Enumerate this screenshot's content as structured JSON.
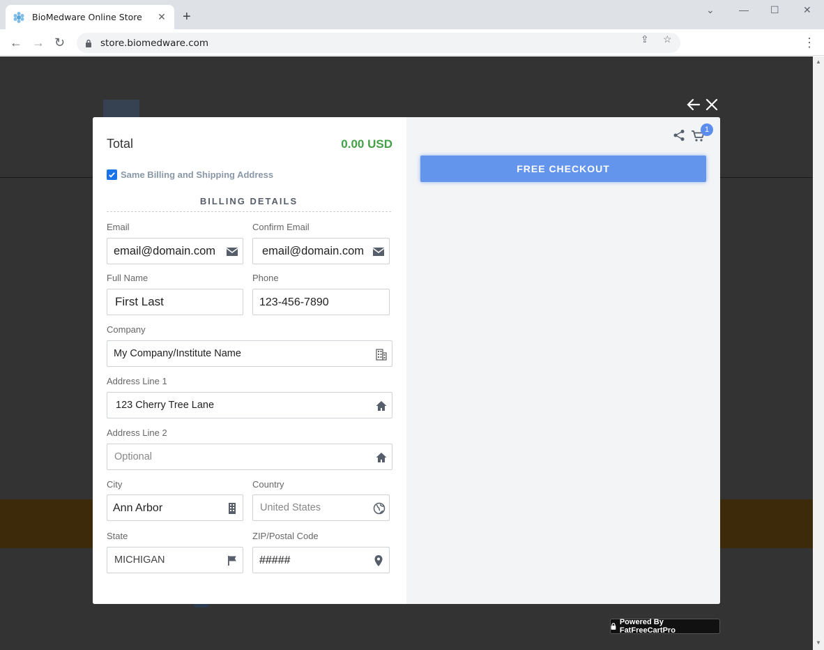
{
  "browser": {
    "tab_title": "BioMedware Online Store",
    "url": "store.biomedware.com"
  },
  "checkout": {
    "total_label": "Total",
    "total_value": "0.00 USD",
    "same_address_label": "Same Billing and Shipping Address",
    "same_address_checked": true,
    "section_title": "BILLING DETAILS",
    "fields": {
      "email": {
        "label": "Email",
        "value": "email@domain.com"
      },
      "confirm_email": {
        "label": "Confirm Email",
        "value": "email@domain.com"
      },
      "full_name": {
        "label": "Full Name",
        "value": "First Last"
      },
      "phone": {
        "label": "Phone",
        "value": "123-456-7890"
      },
      "company": {
        "label": "Company",
        "value": "My Company/Institute Name"
      },
      "address1": {
        "label": "Address Line 1",
        "value": "123 Cherry Tree Lane"
      },
      "address2": {
        "label": "Address Line 2",
        "placeholder": "Optional"
      },
      "city": {
        "label": "City",
        "value": "Ann Arbor"
      },
      "country": {
        "label": "Country",
        "value": "United States"
      },
      "state": {
        "label": "State",
        "value": "MICHIGAN"
      },
      "zip": {
        "label": "ZIP/Postal Code",
        "value": "#####"
      }
    },
    "cart_count": "1",
    "checkout_button": "FREE CHECKOUT",
    "powered_by": "Powered By FatFreeCartPro"
  },
  "colors": {
    "accent": "#6495ed",
    "total_green": "#43a047",
    "badge": "#5b8def"
  }
}
